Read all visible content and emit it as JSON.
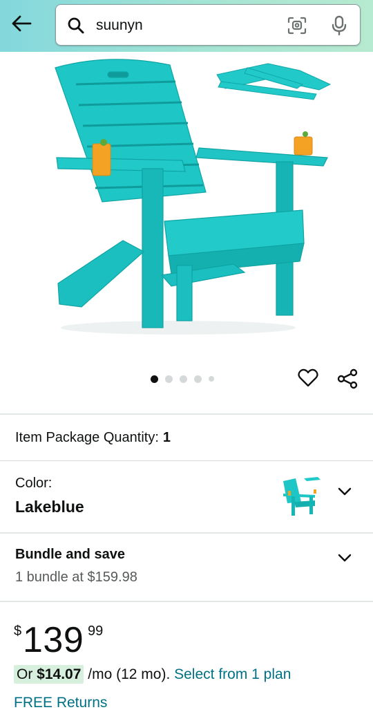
{
  "search": {
    "query": "suunyn"
  },
  "gallery": {
    "image_count": 5,
    "active_index": 0
  },
  "quantity": {
    "label": "Item Package Quantity:",
    "value": "1"
  },
  "color": {
    "label": "Color:",
    "value": "Lakeblue"
  },
  "bundle": {
    "title": "Bundle and save",
    "subtitle": "1 bundle at $159.98"
  },
  "price": {
    "symbol": "$",
    "whole": "139",
    "fraction": "99"
  },
  "installment": {
    "prefix": "Or",
    "amount": "$14.07",
    "term": "/mo (12 mo).",
    "link": "Select from 1 plan"
  },
  "returns": {
    "label": "FREE Returns"
  },
  "colors": {
    "accent_link": "#007185",
    "chair": "#1ec6c6",
    "highlight": "#d7f0dd"
  },
  "icons": [
    "back-arrow-icon",
    "search-icon",
    "camera-lens-icon",
    "microphone-icon",
    "heart-icon",
    "share-icon",
    "chevron-down-icon"
  ]
}
